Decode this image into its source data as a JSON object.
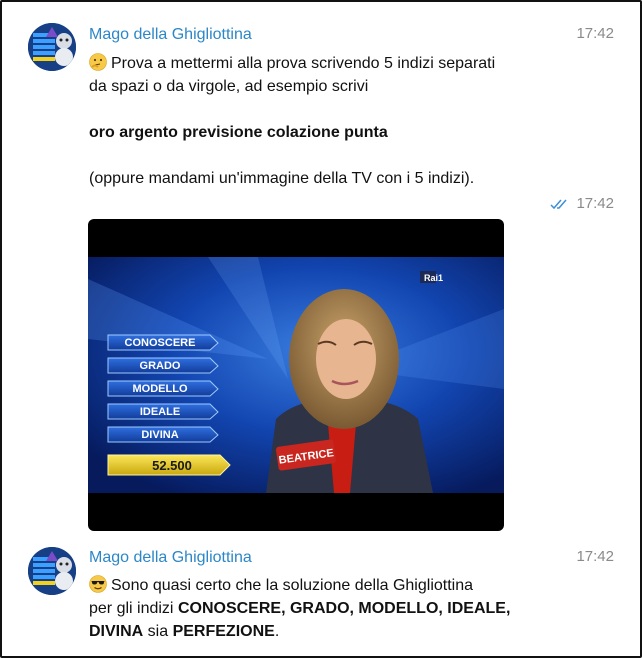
{
  "messages": [
    {
      "sender": "Mago della Ghigliottina",
      "time": "17:42",
      "line1": "Prova a mettermi alla prova scrivendo 5 indizi separati",
      "line2": "da spazi o da virgole, ad esempio scrivi",
      "example": "oro argento previsione colazione punta",
      "line3": "(oppure mandami un'immagine della TV con i 5 indizi).",
      "emoji": "thinking-face"
    },
    {
      "time": "17:42",
      "status": "read"
    },
    {
      "sender": "Mago della Ghigliottina",
      "time": "17:42",
      "emoji": "sunglasses-face",
      "text_a": "Sono quasi certo che la soluzione della Ghigliottina",
      "text_b": "per gli indizi ",
      "clues_bold": "CONOSCERE, GRADO, MODELLO, IDEALE,",
      "clue_last": "DIVINA",
      "text_c": " sia ",
      "solution": "PERFEZIONE",
      "text_d": "."
    }
  ],
  "photo": {
    "clues": [
      "CONOSCERE",
      "GRADO",
      "MODELLO",
      "IDEALE",
      "DIVINA"
    ],
    "prize": "52.500",
    "name_tag": "BEATRICE",
    "logo": "Rai1"
  },
  "colors": {
    "sender": "#2b87c8",
    "time": "#8a8a8a",
    "check": "#3d8fd6",
    "studio": "#0b2f8a",
    "prize": "#f2d21a"
  }
}
